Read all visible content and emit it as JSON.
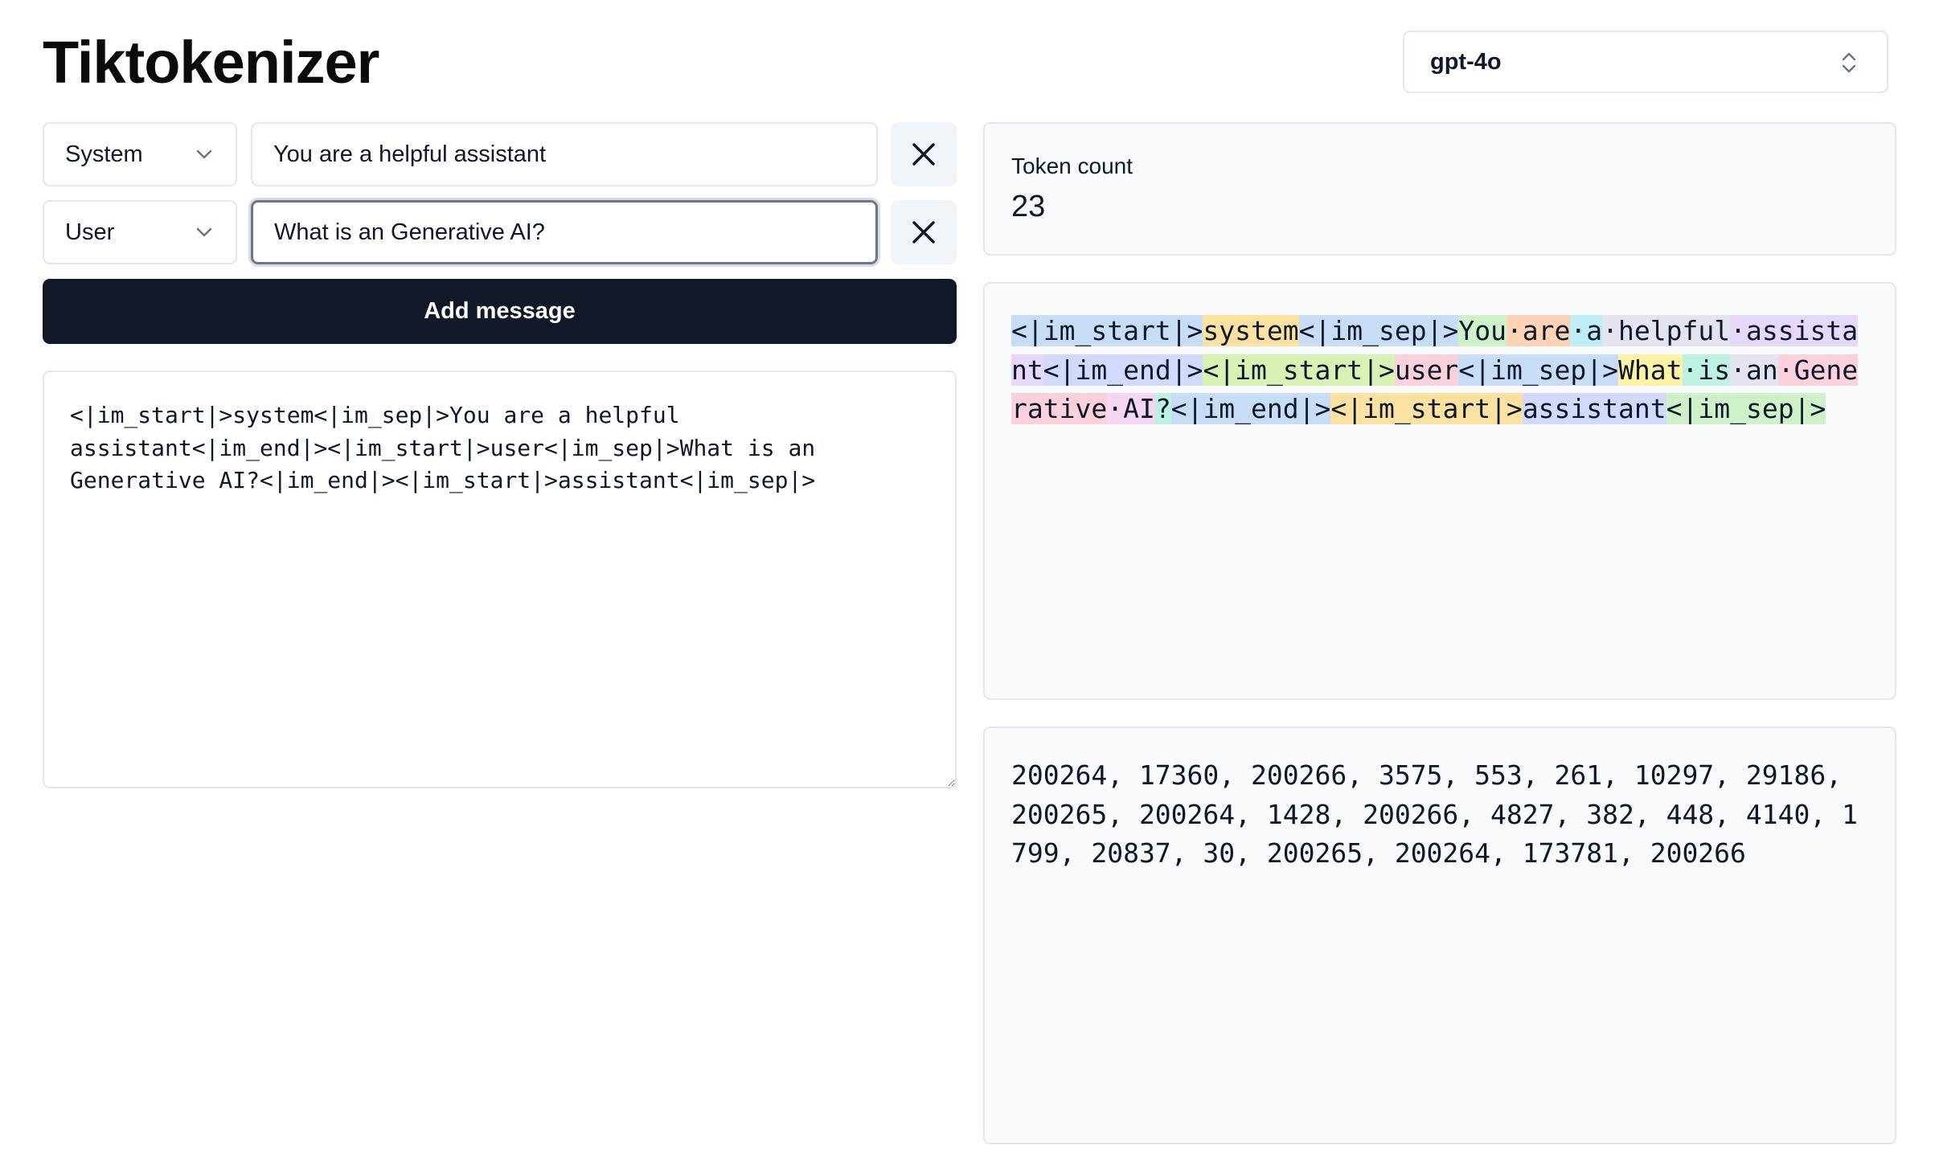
{
  "header": {
    "title": "Tiktokenizer",
    "model": "gpt-4o"
  },
  "messages": [
    {
      "role": "System",
      "content": "You are a helpful assistant"
    },
    {
      "role": "User",
      "content": "What is an Generative AI?"
    }
  ],
  "add_message_label": "Add message",
  "raw_text": "<|im_start|>system<|im_sep|>You are a helpful assistant<|im_end|><|im_start|>user<|im_sep|>What is an Generative AI?<|im_end|><|im_start|>assistant<|im_sep|>",
  "token_count": {
    "label": "Token count",
    "value": "23"
  },
  "tokens": [
    {
      "text": "<|im_start|>",
      "color": "#c7ddf6"
    },
    {
      "text": "system",
      "color": "#fbe2a0"
    },
    {
      "text": "<|im_sep|>",
      "color": "#c7ddf6"
    },
    {
      "text": "You",
      "color": "#cdf2c8"
    },
    {
      "text": "·are",
      "color": "#fdd3b5"
    },
    {
      "text": "·a",
      "color": "#bdedf5"
    },
    {
      "text": "·helpful",
      "color": "#e4e4f0"
    },
    {
      "text": "·assistant",
      "color": "#e6d8fb"
    },
    {
      "text": "<|im_end|>",
      "color": "#d3d9fb"
    },
    {
      "text": "<|im_start|>",
      "color": "#d8f2b3"
    },
    {
      "text": "user",
      "color": "#fbd2dc"
    },
    {
      "text": "<|im_sep|>",
      "color": "#c7ddf6"
    },
    {
      "text": "What",
      "color": "#fdf1a6"
    },
    {
      "text": "·is",
      "color": "#bdf2e3"
    },
    {
      "text": "·an",
      "color": "#e4e4f0"
    },
    {
      "text": "·Generative",
      "color": "#fbd2dc"
    },
    {
      "text": "·AI",
      "color": "#f4d6f2"
    },
    {
      "text": "?",
      "color": "#bdf2e3"
    },
    {
      "text": "<|im_end|>",
      "color": "#c7ddf6"
    },
    {
      "text": "<|im_start|>",
      "color": "#fbe2a0"
    },
    {
      "text": "assistant",
      "color": "#d3d9fb"
    },
    {
      "text": "<|im_sep|>",
      "color": "#cdf2c8"
    }
  ],
  "token_ids_text": "200264, 17360, 200266, 3575, 553, 261, 10297, 29186, 200265, 200264, 1428, 200266, 4827, 382, 448, 4140, 1799, 20837, 30, 200265, 200264, 173781, 200266",
  "icons": {
    "model_select": "chevron-up-down-icon",
    "role_select": "chevron-down-icon",
    "remove": "close-icon"
  }
}
